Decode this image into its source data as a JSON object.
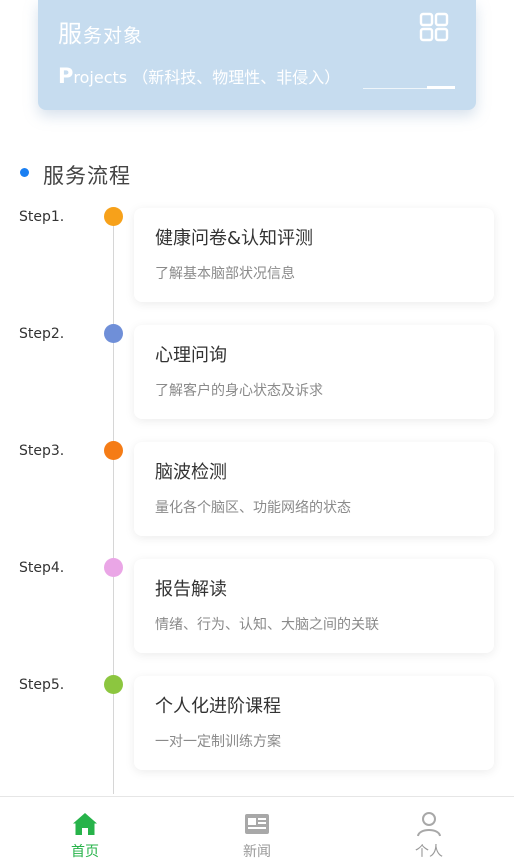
{
  "banner": {
    "title_main": "服",
    "title_rest": "务对象",
    "subtitle_cap": "P",
    "subtitle_rest": "rojects （新科技、物理性、非侵入）",
    "icon": "grid-icon"
  },
  "section": {
    "title": "服务流程"
  },
  "steps": [
    {
      "label": "Step1.",
      "title": "健康问卷&认知评测",
      "desc": "了解基本脑部状况信息",
      "color": "#f7a11a"
    },
    {
      "label": "Step2.",
      "title": "心理问询",
      "desc": "了解客户的身心状态及诉求",
      "color": "#6f8fd8"
    },
    {
      "label": "Step3.",
      "title": "脑波检测",
      "desc": "量化各个脑区、功能网络的状态",
      "color": "#f57c16"
    },
    {
      "label": "Step4.",
      "title": "报告解读",
      "desc": "情绪、行为、认知、大脑之间的关联",
      "color": "#eaa6e6"
    },
    {
      "label": "Step5.",
      "title": "个人化进阶课程",
      "desc": "一对一定制训练方案",
      "color": "#8cc63f"
    }
  ],
  "tabbar": {
    "tabs": [
      {
        "label": "首页",
        "icon": "home-icon",
        "active": true
      },
      {
        "label": "新闻",
        "icon": "news-icon",
        "active": false
      },
      {
        "label": "个人",
        "icon": "user-icon",
        "active": false
      }
    ],
    "active_color": "#27b34a",
    "inactive_color": "#999999"
  }
}
